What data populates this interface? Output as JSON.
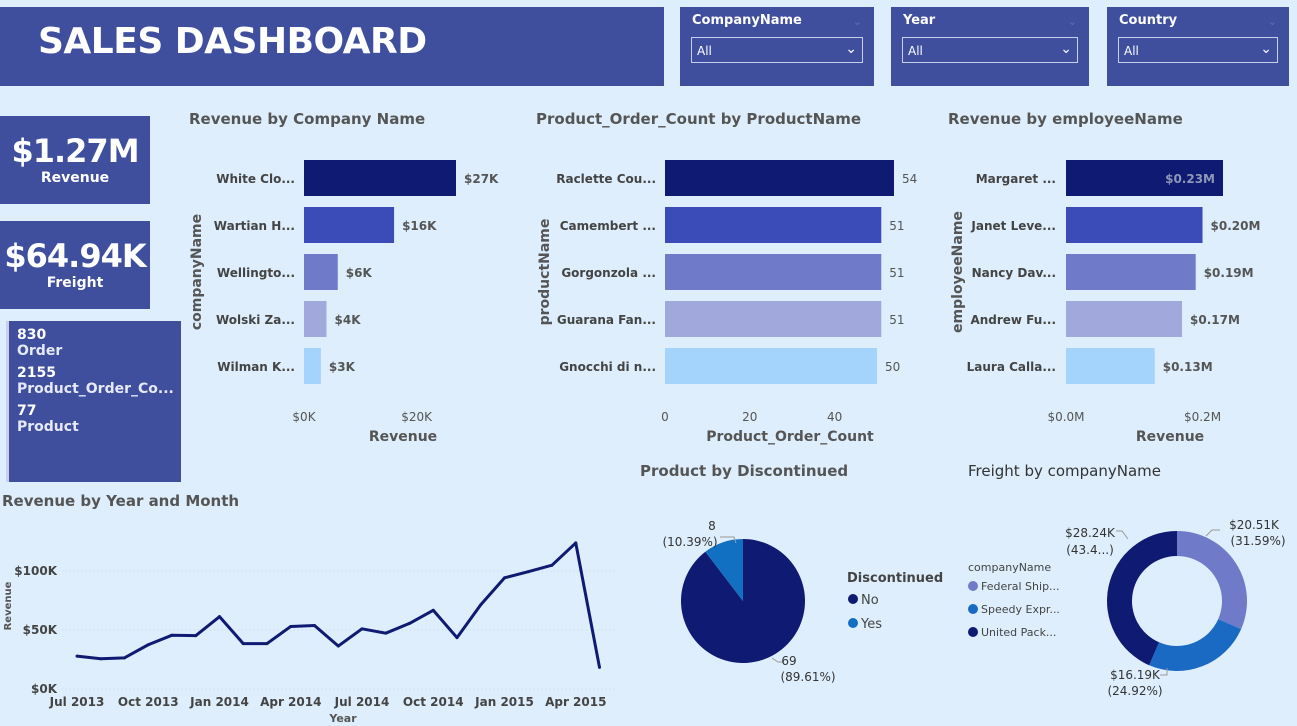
{
  "header": {
    "title": "SALES DASHBOARD"
  },
  "slicers": [
    {
      "label": "CompanyName",
      "value": "All"
    },
    {
      "label": "Year",
      "value": "All"
    },
    {
      "label": "Country",
      "value": "All"
    }
  ],
  "kpis": {
    "revenue": {
      "value": "$1.27M",
      "label": "Revenue"
    },
    "freight": {
      "value": "$64.94K",
      "label": "Freight"
    },
    "multi": [
      {
        "value": "830",
        "label": "Order"
      },
      {
        "value": "2155",
        "label": "Product_Order_Co..."
      },
      {
        "value": "77",
        "label": "Product"
      }
    ]
  },
  "colors": {
    "panel": "#3f4f9e",
    "bg": "#deeefc",
    "navy": "#0f1a73",
    "blue": "#3b4cb8",
    "mid": "#6f7bc9",
    "light": "#a0a8dc",
    "pale": "#a4d4fb",
    "pie_yes": "#1270c2",
    "donut_speedy": "#1a6ac4"
  },
  "chart_data": [
    {
      "id": "revenue_by_company",
      "type": "bar",
      "orientation": "horizontal",
      "title": "Revenue by Company Name",
      "xlabel": "Revenue",
      "ylabel": "companyName",
      "categories": [
        "White Clo...",
        "Wartian H...",
        "Wellingto...",
        "Wolski Za...",
        "Wilman K..."
      ],
      "values": [
        27,
        16,
        6,
        4,
        3
      ],
      "data_labels": [
        "$27K",
        "$16K",
        "$6K",
        "$4K",
        "$3K"
      ],
      "xticks": [
        "$0K",
        "$20K"
      ],
      "xtick_values": [
        0,
        20
      ],
      "xlim": [
        0,
        27
      ],
      "unit": "K"
    },
    {
      "id": "product_order_count",
      "type": "bar",
      "orientation": "horizontal",
      "title": "Product_Order_Count by ProductName",
      "xlabel": "Product_Order_Count",
      "ylabel": "productName",
      "categories": [
        "Raclette Cou...",
        "Camembert ...",
        "Gorgonzola ...",
        "Guarana Fan...",
        "Gnocchi di n..."
      ],
      "values": [
        54,
        51,
        51,
        51,
        50
      ],
      "data_labels": [
        "54",
        "51",
        "51",
        "51",
        "50"
      ],
      "xticks": [
        "0",
        "20",
        "40"
      ],
      "xtick_values": [
        0,
        20,
        40
      ],
      "xlim": [
        0,
        54
      ]
    },
    {
      "id": "revenue_by_employee",
      "type": "bar",
      "orientation": "horizontal",
      "title": "Revenue by employeeName",
      "xlabel": "Revenue",
      "ylabel": "employeeName",
      "categories": [
        "Margaret ...",
        "Janet Leve...",
        "Nancy Dav...",
        "Andrew Fu...",
        "Laura Calla..."
      ],
      "values": [
        0.23,
        0.2,
        0.19,
        0.17,
        0.13
      ],
      "data_labels": [
        "$0.23M",
        "$0.20M",
        "$0.19M",
        "$0.17M",
        "$0.13M"
      ],
      "xticks": [
        "$0.0M",
        "$0.2M"
      ],
      "xtick_values": [
        0,
        0.2
      ],
      "xlim": [
        0,
        0.23
      ]
    },
    {
      "id": "revenue_by_year_month",
      "type": "line",
      "title": "Revenue by Year and Month",
      "xlabel": "Year",
      "ylabel": "Revenue",
      "x": [
        "Jul 2013",
        "Aug 2013",
        "Sep 2013",
        "Oct 2013",
        "Nov 2013",
        "Dec 2013",
        "Jan 2014",
        "Feb 2014",
        "Mar 2014",
        "Apr 2014",
        "May 2014",
        "Jun 2014",
        "Jul 2014",
        "Aug 2014",
        "Sep 2014",
        "Oct 2014",
        "Nov 2014",
        "Dec 2014",
        "Jan 2015",
        "Feb 2015",
        "Mar 2015",
        "Apr 2015",
        "May 2015"
      ],
      "values": [
        27.9,
        25.6,
        26.4,
        37.5,
        45.6,
        45.2,
        61.3,
        38.5,
        38.5,
        53.0,
        53.8,
        36.4,
        51.0,
        47.3,
        55.6,
        66.7,
        43.5,
        71.4,
        94.2,
        99.4,
        104.9,
        123.8,
        18.3
      ],
      "xticks": [
        "Jul 2013",
        "Oct 2013",
        "Jan 2014",
        "Apr 2014",
        "Jul 2014",
        "Oct 2014",
        "Jan 2015",
        "Apr 2015"
      ],
      "yticks": [
        "$0K",
        "$50K",
        "$100K"
      ],
      "ytick_values": [
        0,
        50,
        100
      ],
      "ylim": [
        0,
        128
      ]
    },
    {
      "id": "product_by_discontinued",
      "type": "pie",
      "title": "Product by Discontinued",
      "legend_title": "Discontinued",
      "legend_position": "right",
      "labels": [
        "No",
        "Yes"
      ],
      "values": [
        69,
        8
      ],
      "percent_labels": [
        "(89.61%)",
        "(10.39%)"
      ]
    },
    {
      "id": "freight_by_company",
      "type": "pie",
      "variant": "donut",
      "title": "Freight by companyName",
      "legend_title": "companyName",
      "legend_position": "left",
      "labels": [
        "Federal Ship...",
        "Speedy Expr...",
        "United Pack..."
      ],
      "values": [
        20.51,
        16.19,
        28.24
      ],
      "value_labels": [
        "$20.51K",
        "$16.19K",
        "$28.24K"
      ],
      "percent_labels": [
        "(31.59%)",
        "(24.92%)",
        "(43.4...)"
      ]
    }
  ]
}
